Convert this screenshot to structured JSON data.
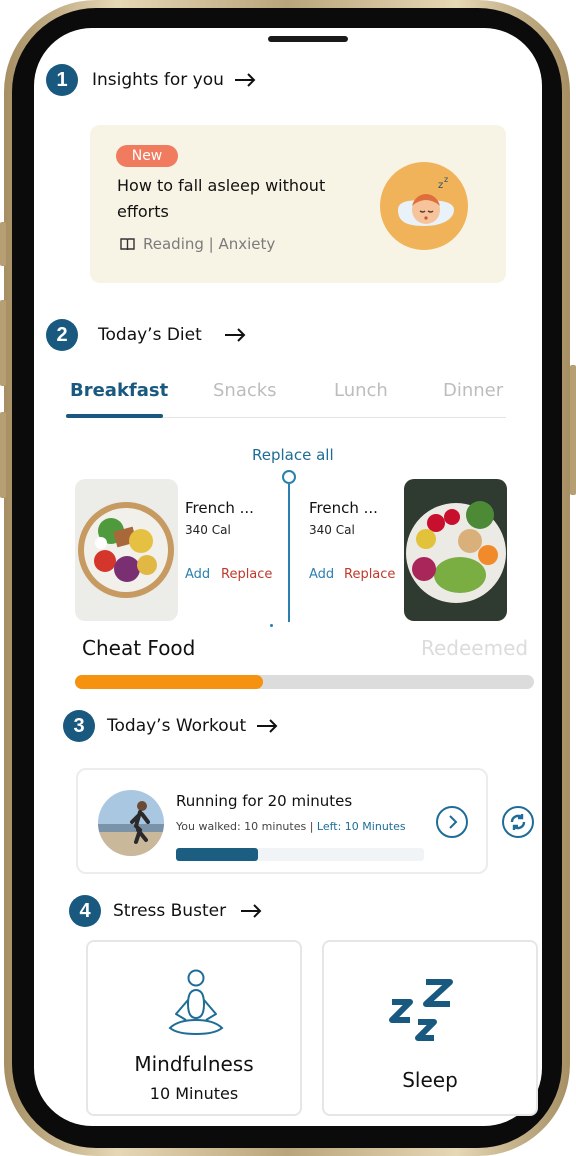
{
  "insights": {
    "section_number": "1",
    "section_title": "Insights for you",
    "card": {
      "badge": "New",
      "title": "How to fall asleep without efforts",
      "meta": "Reading | Anxiety"
    }
  },
  "diet": {
    "section_number": "2",
    "section_title": "Today’s Diet",
    "tabs": [
      {
        "label": "Breakfast",
        "active": true
      },
      {
        "label": "Snacks",
        "active": false
      },
      {
        "label": "Lunch",
        "active": false
      },
      {
        "label": "Dinner",
        "active": false
      }
    ],
    "replace_all": "Replace all",
    "items": [
      {
        "name": "French ...",
        "calories": "340 Cal",
        "add": "Add",
        "replace": "Replace"
      },
      {
        "name": "French ...",
        "calories": "340 Cal",
        "add": "Add",
        "replace": "Replace"
      }
    ],
    "cheat_food": {
      "label": "Cheat Food",
      "status": "Redeemed",
      "progress": 0.41
    }
  },
  "workout": {
    "section_number": "3",
    "section_title": "Today’s Workout",
    "card": {
      "title": "Running for 20 minutes",
      "walked": "You walked: 10 minutes | ",
      "left": "Left: 10 Minutes",
      "progress": 0.33
    }
  },
  "stress": {
    "section_number": "4",
    "section_title": "Stress Buster",
    "cards": [
      {
        "title": "Mindfulness",
        "subtitle": "10 Minutes",
        "icon": "meditation-icon"
      },
      {
        "title": "Sleep",
        "icon": "zzz-icon"
      }
    ]
  },
  "colors": {
    "primary": "#19597f",
    "accent_orange": "#f5920f",
    "badge": "#f07b5f",
    "replace_red": "#c0392b",
    "card_bg": "#f7f4e6"
  }
}
